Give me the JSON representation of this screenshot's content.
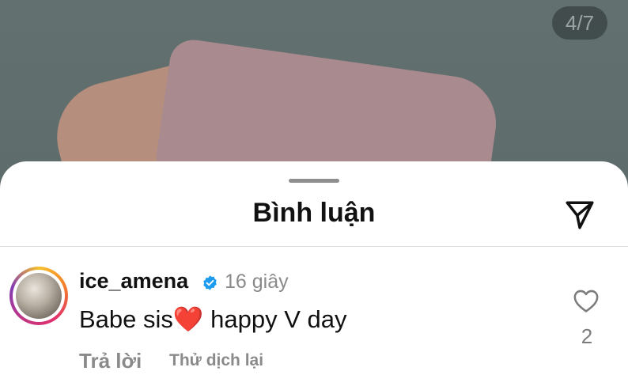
{
  "media": {
    "counter": "4/7"
  },
  "sheet": {
    "title": "Bình luận",
    "share_icon": "send-paper-plane-icon"
  },
  "comment": {
    "username": "ice_amena",
    "verified": true,
    "time": "16 giây",
    "text_before": "Babe sis",
    "emoji": "❤️",
    "text_after": " happy V day",
    "reply_label": "Trả lời",
    "translate_label": "Thử dịch lại",
    "like_count": "2"
  },
  "colors": {
    "verified_badge": "#1d9bf0",
    "heart_emoji": "#e0202f",
    "muted_text": "#8a8a8a"
  }
}
